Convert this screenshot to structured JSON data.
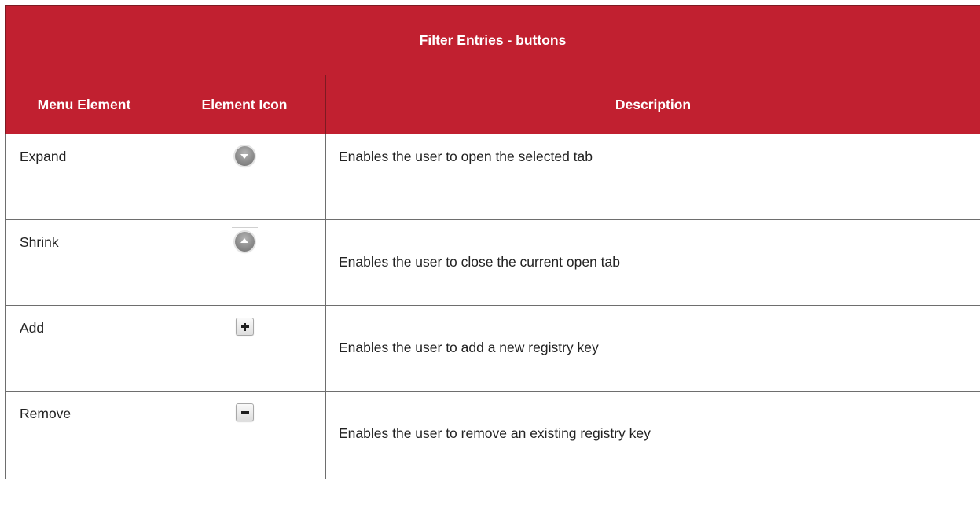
{
  "table": {
    "title": "Filter Entries - buttons",
    "headers": {
      "menu_element": "Menu Element",
      "element_icon": "Element Icon",
      "description": "Description"
    },
    "rows": [
      {
        "name": "Expand",
        "icon": "expand-icon",
        "description": "Enables the user to open the selected tab"
      },
      {
        "name": "Shrink",
        "icon": "shrink-icon",
        "description": "Enables the user to close the current open tab"
      },
      {
        "name": "Add",
        "icon": "plus-icon",
        "description": "Enables the user to add a new registry key"
      },
      {
        "name": "Remove",
        "icon": "minus-icon",
        "description": "Enables the user to remove an existing registry key"
      }
    ]
  },
  "colors": {
    "header_background": "#c12030",
    "header_text": "#ffffff",
    "border": "#6e6e6e",
    "body_text": "#222222"
  }
}
